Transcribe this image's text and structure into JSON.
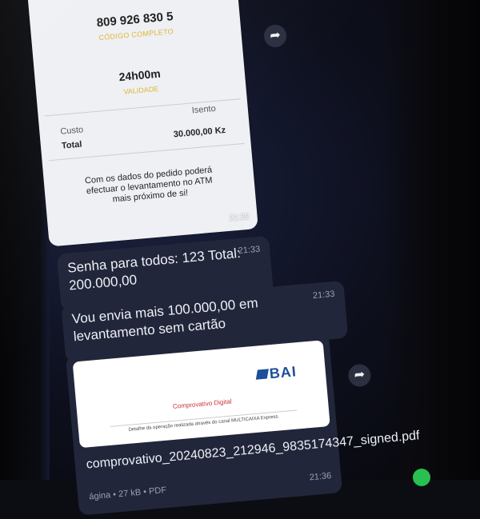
{
  "receipt": {
    "code": "809 926 830 5",
    "code_label": "CÓDIGO COMPLETO",
    "validity": "24h00m",
    "validity_label": "VALIDADE",
    "cost_label": "Custo",
    "cost_value": "Isento",
    "total_label": "Total",
    "total_value": "30.000,00 Kz",
    "note": "Com os dados do pedido poderá efectuar o levantamento no ATM mais próximo de si!",
    "time": "21:32"
  },
  "messages": [
    {
      "text": "Senha para todos: 123 Total: 200.000,00",
      "time": "21:33"
    },
    {
      "text": "Vou envia mais 100.000,00 em levantamento sem cartão",
      "time": "21:33"
    }
  ],
  "attachment": {
    "preview_logo": "BAI",
    "preview_title": "Comprovativo Digital",
    "preview_subtitle": "Detalhe da operação realizada através do canal MULTICAIXA Express.",
    "file_name": "comprovativo_20240823_212946_9835174347_signed.pdf",
    "file_meta": "ágina • 27 kB • PDF",
    "time": "21:36"
  },
  "icons": {
    "forward": "forward-icon"
  },
  "colors": {
    "bubble_dark": "#22263a",
    "receipt_bg": "#eef0f4",
    "label_gold": "#e3b32b",
    "bai_blue": "#1d4f9a"
  }
}
